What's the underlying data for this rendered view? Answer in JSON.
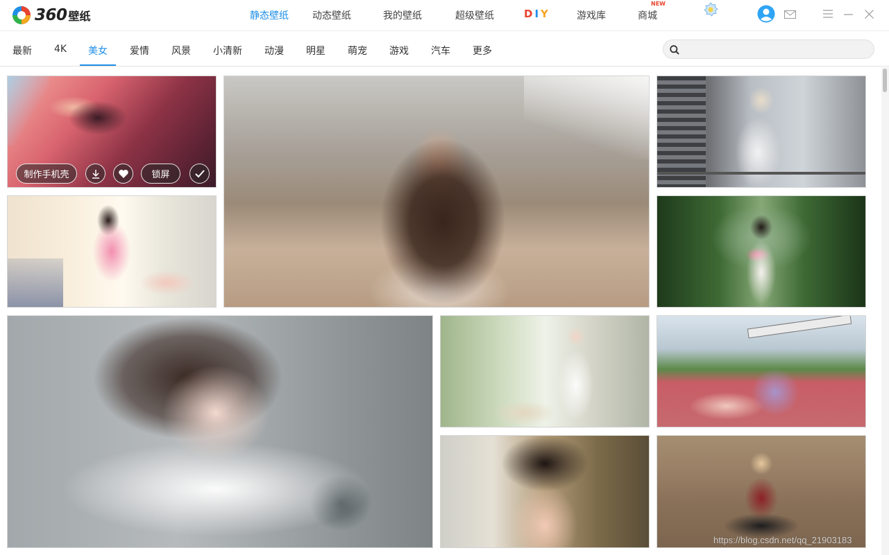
{
  "app": {
    "logo_text": "360",
    "logo_sub": "壁纸"
  },
  "topnav": {
    "items": [
      {
        "label": "静态壁纸",
        "active": true
      },
      {
        "label": "动态壁纸",
        "active": false
      },
      {
        "label": "我的壁纸",
        "active": false
      },
      {
        "label": "超级壁纸",
        "active": false
      },
      {
        "label": "DIY",
        "active": false
      },
      {
        "label": "游戏库",
        "active": false
      },
      {
        "label": "商城",
        "active": false
      }
    ],
    "diy_letters": [
      "D",
      "I",
      "Y"
    ],
    "diy_colors": [
      "#e8432d",
      "#1f8ee8",
      "#f5a623"
    ],
    "new_badge": "NEW"
  },
  "icons": {
    "skin": "gear-badge-icon",
    "user": "user-avatar-icon",
    "mail": "mail-icon",
    "menu": "menu-icon",
    "minimize": "minimize-icon",
    "close": "close-icon",
    "search": "search-icon"
  },
  "categories": {
    "items": [
      "最新",
      "4K",
      "美女",
      "爱情",
      "风景",
      "小清新",
      "动漫",
      "明星",
      "萌宠",
      "游戏",
      "汽车",
      "更多"
    ],
    "active": "美女"
  },
  "search": {
    "value": "",
    "placeholder": ""
  },
  "tile_overlay": {
    "make_case_label": "制作手机壳",
    "lock_screen_label": "锁屏"
  },
  "colors": {
    "accent": "#1f8ee8",
    "user_icon": "#2fa4f5"
  },
  "watermark": "https://blog.csdn.net/qq_21903183"
}
